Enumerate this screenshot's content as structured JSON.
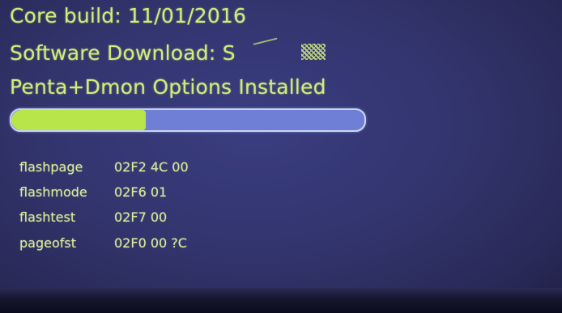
{
  "status": {
    "core_build": "Core build: 11/01/2016",
    "software_download": "Software Download: S",
    "options_installed": "Penta+Dmon Options Installed"
  },
  "progress": {
    "fraction": 0.38,
    "fill_color": "#b8e64a",
    "track_color": "#6f7fd6"
  },
  "registers": [
    {
      "name": "flashpage",
      "value": "02F2 4C 00"
    },
    {
      "name": "flashmode",
      "value": "02F6 01"
    },
    {
      "name": "flashtest",
      "value": "02F7 00"
    },
    {
      "name": "pageofst",
      "value": "02F0 00 ?C"
    }
  ],
  "colors": {
    "text": "#d2ec7a",
    "screen_background": "#33356f"
  }
}
